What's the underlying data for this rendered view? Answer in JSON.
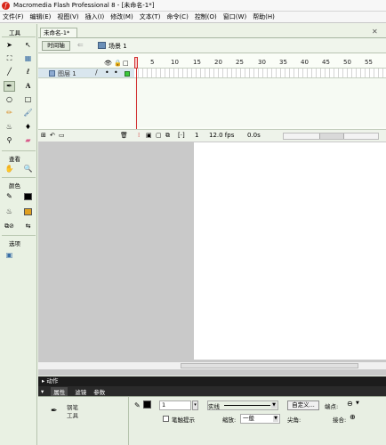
{
  "titlebar": {
    "logo_glyph": "f",
    "title": "Macromedia Flash Professional 8 - [未命名-1*]"
  },
  "menubar": {
    "items": [
      "文件(F)",
      "编辑(E)",
      "视图(V)",
      "插入(I)",
      "修改(M)",
      "文本(T)",
      "命令(C)",
      "控制(O)",
      "窗口(W)",
      "帮助(H)"
    ]
  },
  "tools": {
    "title": "工具",
    "view_label": "查看",
    "colors_label": "颜色",
    "options_label": "选项"
  },
  "document": {
    "tab": "未命名-1*",
    "timeline_button": "时间轴",
    "scene": "场景 1"
  },
  "timeline": {
    "frame_numbers": [
      "5",
      "10",
      "15",
      "20",
      "25",
      "30",
      "35",
      "40",
      "45",
      "50",
      "55"
    ],
    "layer_name": "图层 1",
    "current_frame": "1",
    "frame_rate": "12.0 fps",
    "elapsed": "0.0s"
  },
  "panels": {
    "actions": "动作",
    "tabs": [
      "属性",
      "滤镜",
      "参数"
    ]
  },
  "properties": {
    "tool_name_line1": "钢笔",
    "tool_name_line2": "工具",
    "stroke_size": "1",
    "stroke_style": "实线",
    "custom_button": "自定义...",
    "endpoint_label": "端点:",
    "stroke_hint_label": "笔触提示",
    "scale_label": "缩放:",
    "scale_value": "一般",
    "corner_label": "尖角:",
    "join_label": "接合:"
  },
  "colors": {
    "accent": "#d23030",
    "layer_green": "#3bc93b",
    "panel_bg": "#ecf2e6",
    "fill_color": "#e0a020"
  }
}
